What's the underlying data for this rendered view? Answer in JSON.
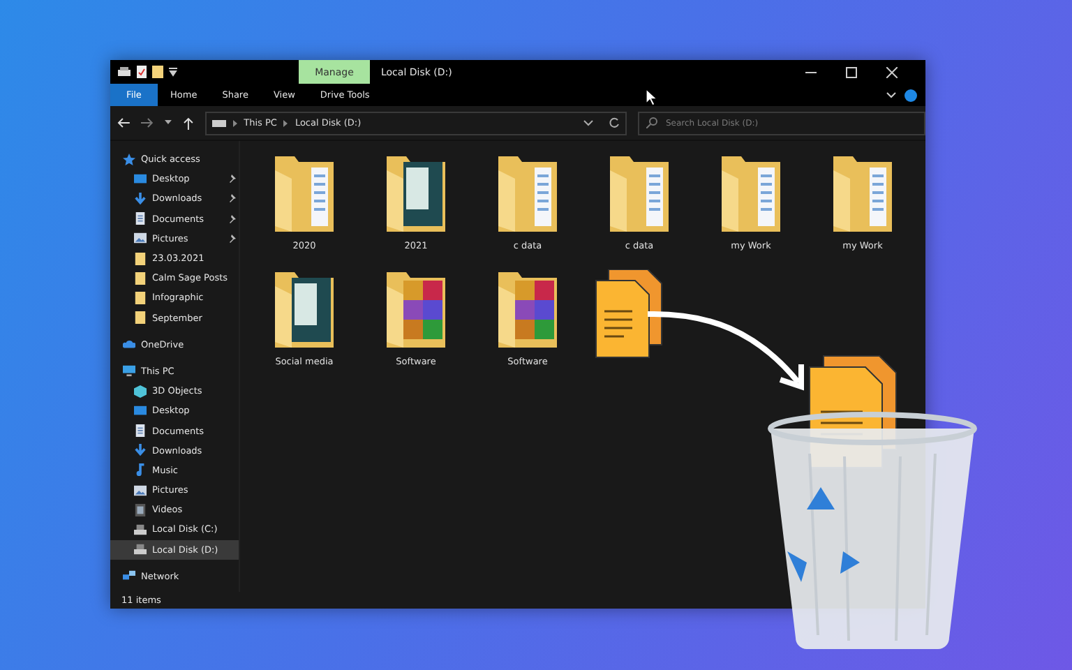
{
  "window": {
    "context_tab": "Manage",
    "title": "Local Disk (D:)",
    "ribbon_tabs": [
      {
        "label": "File",
        "selected": true
      },
      {
        "label": "Home",
        "selected": false
      },
      {
        "label": "Share",
        "selected": false
      },
      {
        "label": "View",
        "selected": false
      },
      {
        "label": "Drive Tools",
        "selected": false
      }
    ],
    "address": {
      "crumbs": [
        "This PC",
        "Local Disk (D:)"
      ]
    },
    "search": {
      "placeholder": "Search Local Disk (D:)"
    },
    "sidebar": {
      "items": [
        {
          "label": "Quick access",
          "kind": "star",
          "selected": false,
          "children": [
            {
              "label": "Desktop",
              "kind": "desktop",
              "selected": false,
              "pinned": true
            },
            {
              "label": "Downloads",
              "kind": "download",
              "selected": false,
              "pinned": true
            },
            {
              "label": "Documents",
              "kind": "document",
              "selected": false,
              "pinned": true
            },
            {
              "label": "Pictures",
              "kind": "picture",
              "selected": false,
              "pinned": true
            },
            {
              "label": "23.03.2021",
              "kind": "folder",
              "selected": false,
              "pinned": false
            },
            {
              "label": "Calm Sage Posts",
              "kind": "folder",
              "selected": false,
              "pinned": false
            },
            {
              "label": "Infographic",
              "kind": "folder",
              "selected": false,
              "pinned": false
            },
            {
              "label": "September",
              "kind": "folder",
              "selected": false,
              "pinned": false
            }
          ]
        },
        {
          "label": "OneDrive",
          "kind": "cloud",
          "selected": false
        },
        {
          "label": "This PC",
          "kind": "pc",
          "selected": false,
          "children": [
            {
              "label": "3D Objects",
              "kind": "cube",
              "selected": false
            },
            {
              "label": "Desktop",
              "kind": "desktop",
              "selected": false
            },
            {
              "label": "Documents",
              "kind": "document",
              "selected": false
            },
            {
              "label": "Downloads",
              "kind": "download",
              "selected": false
            },
            {
              "label": "Music",
              "kind": "music",
              "selected": false
            },
            {
              "label": "Pictures",
              "kind": "picture",
              "selected": false
            },
            {
              "label": "Videos",
              "kind": "video",
              "selected": false
            },
            {
              "label": "Local Disk (C:)",
              "kind": "drive",
              "selected": false
            },
            {
              "label": "Local Disk (D:)",
              "kind": "drive",
              "selected": true
            }
          ]
        },
        {
          "label": "Network",
          "kind": "network",
          "selected": false
        }
      ]
    },
    "files": [
      {
        "name": "2020",
        "kind": "folder"
      },
      {
        "name": "2021",
        "kind": "photo"
      },
      {
        "name": "c data",
        "kind": "folder"
      },
      {
        "name": "c data",
        "kind": "folder"
      },
      {
        "name": "my Work",
        "kind": "folder"
      },
      {
        "name": "my Work",
        "kind": "folder"
      },
      {
        "name": "Social media",
        "kind": "photo"
      },
      {
        "name": "Software",
        "kind": "archive"
      },
      {
        "name": "Software",
        "kind": "archive"
      }
    ],
    "status_bar": {
      "count": "11 items"
    }
  }
}
